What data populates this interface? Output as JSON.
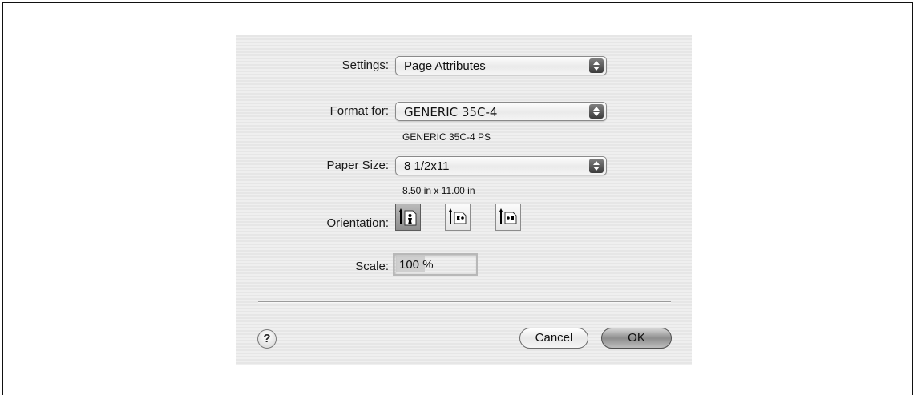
{
  "dialog": {
    "settings": {
      "label": "Settings:",
      "value": "Page Attributes"
    },
    "format_for": {
      "label": "Format for:",
      "value": "GENERIC 35C-4",
      "sub": "GENERIC 35C-4 PS"
    },
    "paper_size": {
      "label": "Paper Size:",
      "value": "8 1/2x11",
      "sub": "8.50 in x 11.00 in"
    },
    "orientation": {
      "label": "Orientation:",
      "options": [
        {
          "icon": "portrait-orientation-icon",
          "selected": true
        },
        {
          "icon": "landscape-left-orientation-icon",
          "selected": false
        },
        {
          "icon": "landscape-right-orientation-icon",
          "selected": false
        }
      ]
    },
    "scale": {
      "label": "Scale:",
      "value": "100 %"
    },
    "help_label": "?",
    "cancel_label": "Cancel",
    "ok_label": "OK"
  }
}
